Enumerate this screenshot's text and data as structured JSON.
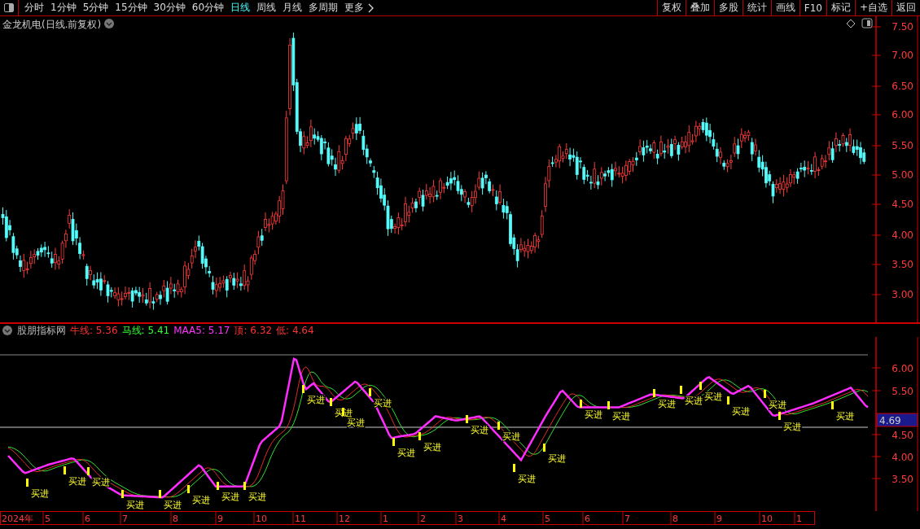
{
  "toolbar": {
    "periods": [
      {
        "label": "分时",
        "selected": false
      },
      {
        "label": "1分钟",
        "selected": false
      },
      {
        "label": "5分钟",
        "selected": false
      },
      {
        "label": "15分钟",
        "selected": false
      },
      {
        "label": "30分钟",
        "selected": false
      },
      {
        "label": "60分钟",
        "selected": false
      },
      {
        "label": "日线",
        "selected": true
      },
      {
        "label": "周线",
        "selected": false
      },
      {
        "label": "月线",
        "selected": false
      },
      {
        "label": "多周期",
        "selected": false
      },
      {
        "label": "更多",
        "selected": false
      }
    ],
    "buttons": [
      "复权",
      "叠加",
      "多股",
      "统计",
      "画线",
      "F10",
      "标记",
      "+自选",
      "返回"
    ]
  },
  "chart": {
    "title": "金龙机电(日线.前复权)",
    "price_axis": [
      "7.50",
      "7.00",
      "6.50",
      "6.00",
      "5.50",
      "5.00",
      "4.50",
      "4.00",
      "3.50",
      "3.00"
    ]
  },
  "indicator": {
    "name": "股朋指标网",
    "values": [
      {
        "text": "牛线: 5.36",
        "color": "#ff3232"
      },
      {
        "text": "马线: 5.41",
        "color": "#32ff32"
      },
      {
        "text": "MAA5: 5.17",
        "color": "#ff32ff"
      },
      {
        "text": "顶: 6.32",
        "color": "#ff3232"
      },
      {
        "text": "低: 4.64",
        "color": "#ff3232"
      }
    ],
    "axis": [
      "6.00",
      "5.50",
      "4.50",
      "4.00",
      "3.50"
    ],
    "current_value": "4.69",
    "signals": [
      {
        "label": "买进"
      },
      {
        "label": "买进"
      },
      {
        "label": "买进"
      },
      {
        "label": "买进"
      },
      {
        "label": "买进"
      },
      {
        "label": "买进"
      },
      {
        "label": "买进"
      },
      {
        "label": "买进"
      },
      {
        "label": "买进"
      },
      {
        "label": "买进"
      },
      {
        "label": "买进"
      },
      {
        "label": "买进"
      },
      {
        "label": "买进"
      },
      {
        "label": "买进"
      },
      {
        "label": "买进"
      },
      {
        "label": "买进"
      },
      {
        "label": "买进"
      },
      {
        "label": "买进"
      },
      {
        "label": "买进"
      },
      {
        "label": "买进"
      },
      {
        "label": "买进"
      },
      {
        "label": "买进"
      },
      {
        "label": "买进"
      },
      {
        "label": "买进"
      },
      {
        "label": "买进"
      },
      {
        "label": "买进"
      },
      {
        "label": "买进"
      }
    ]
  },
  "date_axis": [
    "2024年",
    "5",
    "6",
    "7",
    "8",
    "9",
    "10",
    "11",
    "12",
    "1",
    "2",
    "3",
    "4",
    "5",
    "6",
    "7",
    "8",
    "9",
    "10",
    "1"
  ]
}
